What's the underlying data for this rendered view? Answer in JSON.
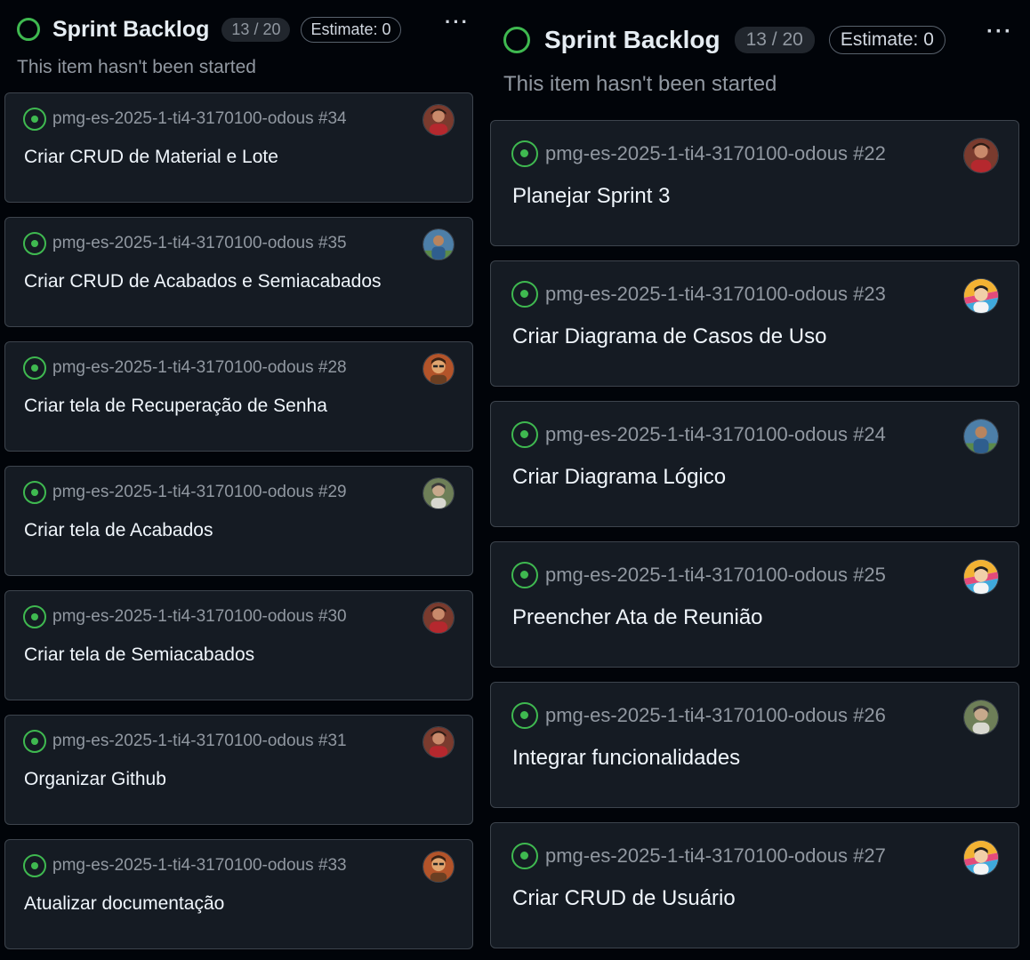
{
  "columns": [
    {
      "title": "Sprint Backlog",
      "count": "13 / 20",
      "estimate": "Estimate: 0",
      "more": "···",
      "subtitle": "This item hasn't been started",
      "cards": [
        {
          "repo": "pmg-es-2025-1-ti4-3170100-odous #34",
          "title": "Criar CRUD de Material e Lote",
          "avatar": "avatar-red"
        },
        {
          "repo": "pmg-es-2025-1-ti4-3170100-odous #35",
          "title": "Criar CRUD de Acabados e Semiacabados",
          "avatar": "avatar-blue"
        },
        {
          "repo": "pmg-es-2025-1-ti4-3170100-odous #28",
          "title": "Criar tela de Recuperação de Senha",
          "avatar": "avatar-orange"
        },
        {
          "repo": "pmg-es-2025-1-ti4-3170100-odous #29",
          "title": "Criar tela de Acabados",
          "avatar": "avatar-green"
        },
        {
          "repo": "pmg-es-2025-1-ti4-3170100-odous #30",
          "title": "Criar tela de Semiacabados",
          "avatar": "avatar-red"
        },
        {
          "repo": "pmg-es-2025-1-ti4-3170100-odous #31",
          "title": "Organizar Github",
          "avatar": "avatar-red"
        },
        {
          "repo": "pmg-es-2025-1-ti4-3170100-odous #33",
          "title": "Atualizar documentação",
          "avatar": "avatar-orange"
        }
      ]
    },
    {
      "title": "Sprint Backlog",
      "count": "13 / 20",
      "estimate": "Estimate: 0",
      "more": "···",
      "subtitle": "This item hasn't been started",
      "cards": [
        {
          "repo": "pmg-es-2025-1-ti4-3170100-odous #22",
          "title": "Planejar Sprint 3",
          "avatar": "avatar-red"
        },
        {
          "repo": "pmg-es-2025-1-ti4-3170100-odous #23",
          "title": "Criar Diagrama de Casos de Uso",
          "avatar": "avatar-colorful"
        },
        {
          "repo": "pmg-es-2025-1-ti4-3170100-odous #24",
          "title": "Criar Diagrama Lógico",
          "avatar": "avatar-blue"
        },
        {
          "repo": "pmg-es-2025-1-ti4-3170100-odous #25",
          "title": "Preencher Ata de Reunião",
          "avatar": "avatar-colorful"
        },
        {
          "repo": "pmg-es-2025-1-ti4-3170100-odous #26",
          "title": "Integrar funcionalidades",
          "avatar": "avatar-green"
        },
        {
          "repo": "pmg-es-2025-1-ti4-3170100-odous #27",
          "title": "Criar CRUD de Usuário",
          "avatar": "avatar-colorful"
        }
      ]
    }
  ],
  "colors": {
    "background": "#010409",
    "card": "#151b23",
    "card_border": "#3d444d",
    "status_green": "#3fb950",
    "muted_text": "#9198a1",
    "title_text": "#f0f6fc"
  }
}
